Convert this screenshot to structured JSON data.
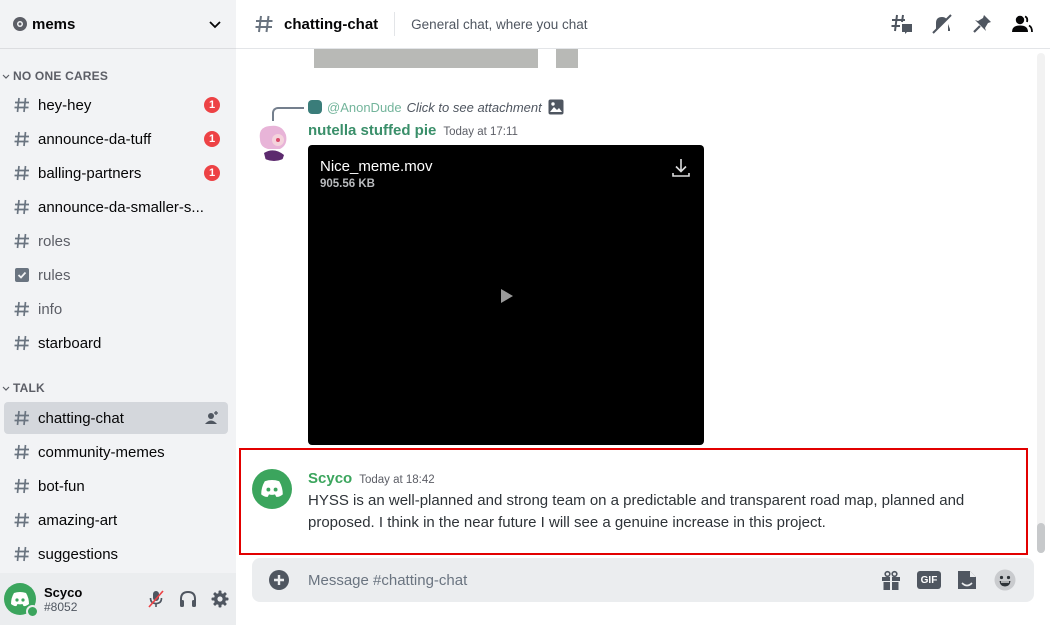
{
  "server": {
    "name": "mems"
  },
  "categories": [
    {
      "name": "NO ONE CARES"
    },
    {
      "name": "TALK"
    }
  ],
  "channels_no_one_cares": [
    {
      "name": "hey-hey",
      "type": "text",
      "unread": true,
      "mentions": "1"
    },
    {
      "name": "announce-da-tuff",
      "type": "text",
      "unread": true,
      "mentions": "1"
    },
    {
      "name": "balling-partners",
      "type": "text",
      "unread": true,
      "mentions": "1"
    },
    {
      "name": "announce-da-smaller-s...",
      "type": "text",
      "unread": true
    },
    {
      "name": "roles",
      "type": "text",
      "unread": false
    },
    {
      "name": "rules",
      "type": "rules",
      "unread": false
    },
    {
      "name": "info",
      "type": "text",
      "unread": false
    },
    {
      "name": "starboard",
      "type": "text",
      "unread": true
    }
  ],
  "channels_talk": [
    {
      "name": "chatting-chat",
      "type": "text",
      "active": true
    },
    {
      "name": "community-memes",
      "type": "text"
    },
    {
      "name": "bot-fun",
      "type": "text"
    },
    {
      "name": "amazing-art",
      "type": "text"
    },
    {
      "name": "suggestions",
      "type": "text"
    }
  ],
  "user": {
    "name": "Scyco",
    "tag": "#8052",
    "status": "online"
  },
  "header": {
    "channel": "chatting-chat",
    "topic": "General chat, where you chat",
    "icons": [
      "threads-icon",
      "notification-muted-icon",
      "pinned-icon",
      "member-list-icon"
    ]
  },
  "messages": [
    {
      "reply": {
        "author": "@AnonDude",
        "text": "Click to see attachment"
      },
      "author": "nutella stuffed pie",
      "author_color": "#3ba55d",
      "timestamp": "Today at 17:11",
      "attachment": {
        "filename": "Nice_meme.mov",
        "size": "905.56 KB"
      }
    },
    {
      "author": "Scyco",
      "author_color": "#3ba55d",
      "timestamp": "Today at 18:42",
      "content": "HYSS is an well-planned and strong team on a predictable and transparent road map, planned and proposed. I think in the near future I will see a genuine increase in this project."
    }
  ],
  "composer": {
    "placeholder": "Message #chatting-chat",
    "gif_label": "GIF"
  },
  "colors": {
    "accent_green": "#3ba55d",
    "mention_red": "#ed4245",
    "highlight_border": "#e20000"
  }
}
